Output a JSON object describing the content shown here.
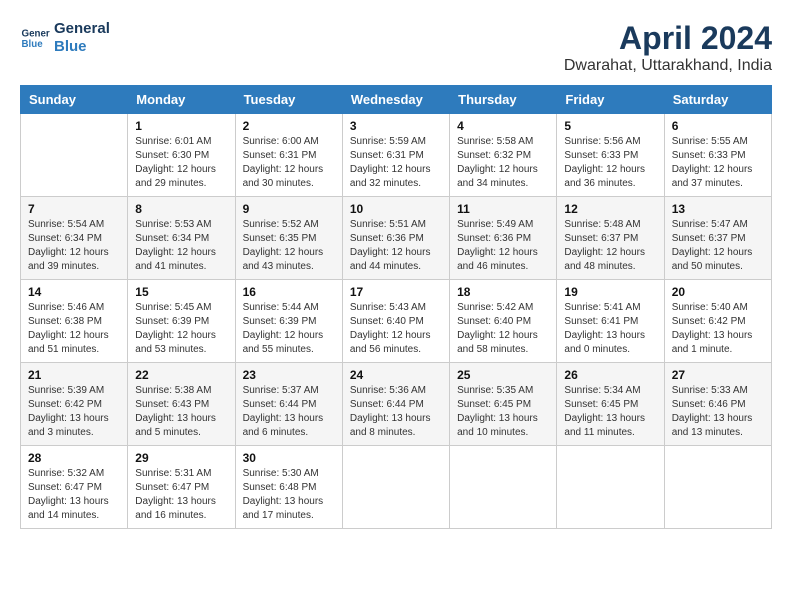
{
  "header": {
    "logo_line1": "General",
    "logo_line2": "Blue",
    "title": "April 2024",
    "subtitle": "Dwarahat, Uttarakhand, India"
  },
  "days_of_week": [
    "Sunday",
    "Monday",
    "Tuesday",
    "Wednesday",
    "Thursday",
    "Friday",
    "Saturday"
  ],
  "weeks": [
    [
      {
        "day": "",
        "info": ""
      },
      {
        "day": "1",
        "info": "Sunrise: 6:01 AM\nSunset: 6:30 PM\nDaylight: 12 hours\nand 29 minutes."
      },
      {
        "day": "2",
        "info": "Sunrise: 6:00 AM\nSunset: 6:31 PM\nDaylight: 12 hours\nand 30 minutes."
      },
      {
        "day": "3",
        "info": "Sunrise: 5:59 AM\nSunset: 6:31 PM\nDaylight: 12 hours\nand 32 minutes."
      },
      {
        "day": "4",
        "info": "Sunrise: 5:58 AM\nSunset: 6:32 PM\nDaylight: 12 hours\nand 34 minutes."
      },
      {
        "day": "5",
        "info": "Sunrise: 5:56 AM\nSunset: 6:33 PM\nDaylight: 12 hours\nand 36 minutes."
      },
      {
        "day": "6",
        "info": "Sunrise: 5:55 AM\nSunset: 6:33 PM\nDaylight: 12 hours\nand 37 minutes."
      }
    ],
    [
      {
        "day": "7",
        "info": "Sunrise: 5:54 AM\nSunset: 6:34 PM\nDaylight: 12 hours\nand 39 minutes."
      },
      {
        "day": "8",
        "info": "Sunrise: 5:53 AM\nSunset: 6:34 PM\nDaylight: 12 hours\nand 41 minutes."
      },
      {
        "day": "9",
        "info": "Sunrise: 5:52 AM\nSunset: 6:35 PM\nDaylight: 12 hours\nand 43 minutes."
      },
      {
        "day": "10",
        "info": "Sunrise: 5:51 AM\nSunset: 6:36 PM\nDaylight: 12 hours\nand 44 minutes."
      },
      {
        "day": "11",
        "info": "Sunrise: 5:49 AM\nSunset: 6:36 PM\nDaylight: 12 hours\nand 46 minutes."
      },
      {
        "day": "12",
        "info": "Sunrise: 5:48 AM\nSunset: 6:37 PM\nDaylight: 12 hours\nand 48 minutes."
      },
      {
        "day": "13",
        "info": "Sunrise: 5:47 AM\nSunset: 6:37 PM\nDaylight: 12 hours\nand 50 minutes."
      }
    ],
    [
      {
        "day": "14",
        "info": "Sunrise: 5:46 AM\nSunset: 6:38 PM\nDaylight: 12 hours\nand 51 minutes."
      },
      {
        "day": "15",
        "info": "Sunrise: 5:45 AM\nSunset: 6:39 PM\nDaylight: 12 hours\nand 53 minutes."
      },
      {
        "day": "16",
        "info": "Sunrise: 5:44 AM\nSunset: 6:39 PM\nDaylight: 12 hours\nand 55 minutes."
      },
      {
        "day": "17",
        "info": "Sunrise: 5:43 AM\nSunset: 6:40 PM\nDaylight: 12 hours\nand 56 minutes."
      },
      {
        "day": "18",
        "info": "Sunrise: 5:42 AM\nSunset: 6:40 PM\nDaylight: 12 hours\nand 58 minutes."
      },
      {
        "day": "19",
        "info": "Sunrise: 5:41 AM\nSunset: 6:41 PM\nDaylight: 13 hours\nand 0 minutes."
      },
      {
        "day": "20",
        "info": "Sunrise: 5:40 AM\nSunset: 6:42 PM\nDaylight: 13 hours\nand 1 minute."
      }
    ],
    [
      {
        "day": "21",
        "info": "Sunrise: 5:39 AM\nSunset: 6:42 PM\nDaylight: 13 hours\nand 3 minutes."
      },
      {
        "day": "22",
        "info": "Sunrise: 5:38 AM\nSunset: 6:43 PM\nDaylight: 13 hours\nand 5 minutes."
      },
      {
        "day": "23",
        "info": "Sunrise: 5:37 AM\nSunset: 6:44 PM\nDaylight: 13 hours\nand 6 minutes."
      },
      {
        "day": "24",
        "info": "Sunrise: 5:36 AM\nSunset: 6:44 PM\nDaylight: 13 hours\nand 8 minutes."
      },
      {
        "day": "25",
        "info": "Sunrise: 5:35 AM\nSunset: 6:45 PM\nDaylight: 13 hours\nand 10 minutes."
      },
      {
        "day": "26",
        "info": "Sunrise: 5:34 AM\nSunset: 6:45 PM\nDaylight: 13 hours\nand 11 minutes."
      },
      {
        "day": "27",
        "info": "Sunrise: 5:33 AM\nSunset: 6:46 PM\nDaylight: 13 hours\nand 13 minutes."
      }
    ],
    [
      {
        "day": "28",
        "info": "Sunrise: 5:32 AM\nSunset: 6:47 PM\nDaylight: 13 hours\nand 14 minutes."
      },
      {
        "day": "29",
        "info": "Sunrise: 5:31 AM\nSunset: 6:47 PM\nDaylight: 13 hours\nand 16 minutes."
      },
      {
        "day": "30",
        "info": "Sunrise: 5:30 AM\nSunset: 6:48 PM\nDaylight: 13 hours\nand 17 minutes."
      },
      {
        "day": "",
        "info": ""
      },
      {
        "day": "",
        "info": ""
      },
      {
        "day": "",
        "info": ""
      },
      {
        "day": "",
        "info": ""
      }
    ]
  ]
}
